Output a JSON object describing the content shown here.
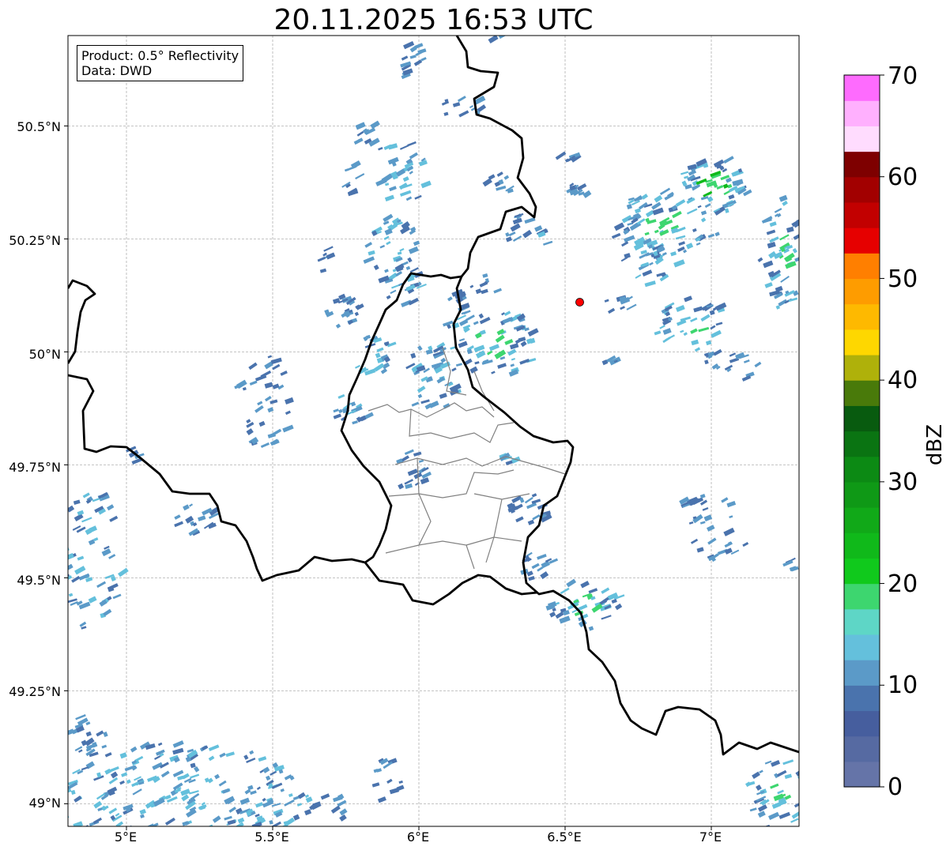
{
  "title": "20.11.2025 16:53 UTC",
  "infobox": {
    "product": "Product: 0.5° Reflectivity",
    "data": "Data: DWD"
  },
  "axes": {
    "lat_ticks": [
      "50.5°N",
      "50.25°N",
      "50°N",
      "49.75°N",
      "49.5°N",
      "49.25°N",
      "49°N"
    ],
    "lon_ticks": [
      "5°E",
      "5.5°E",
      "6°E",
      "6.5°E",
      "7°E"
    ],
    "lat_range": [
      48.95,
      50.7
    ],
    "lon_range": [
      4.8,
      7.3
    ],
    "grid": true
  },
  "colorbar": {
    "label": "dBZ",
    "ticks": [
      "0",
      "10",
      "20",
      "30",
      "40",
      "50",
      "60",
      "70"
    ],
    "range": [
      0,
      70
    ],
    "step": 2.5,
    "colors": [
      "#6574a8",
      "#566aa2",
      "#465e9e",
      "#4a73ad",
      "#5b9ac8",
      "#64c0dc",
      "#5ed6c6",
      "#3dd66f",
      "#10c91c",
      "#10b91a",
      "#11a918",
      "#0f9916",
      "#0c8a14",
      "#0a7412",
      "#085b0f",
      "#497a0a",
      "#afb10a",
      "#fed700",
      "#feb900",
      "#fe9c00",
      "#ff7f00",
      "#e60000",
      "#c20000",
      "#a20000",
      "#7e0000",
      "#ffdcfe",
      "#ffb0fe",
      "#fe6bfe",
      "#ea36ea"
    ]
  },
  "marker": {
    "lat": 50.11,
    "lon": 6.55,
    "color": "#ff0000"
  },
  "echo_colors": [
    "#4a73ad",
    "#5b9ac8",
    "#64c0dc",
    "#3dd66f",
    "#10b91a"
  ]
}
